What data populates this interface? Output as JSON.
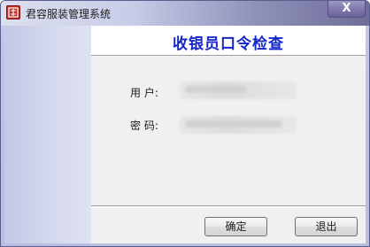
{
  "window": {
    "title": "君容服装管理系统",
    "close_label": "X",
    "app_icon": "app-logo-icon"
  },
  "dialog": {
    "heading": "收银员口令检查",
    "user_label": "用    户:",
    "password_label": "密    码:",
    "ok_label": "确定",
    "exit_label": "退出"
  },
  "colors": {
    "heading_color": "#1426c8",
    "icon_color": "#c0302b"
  }
}
